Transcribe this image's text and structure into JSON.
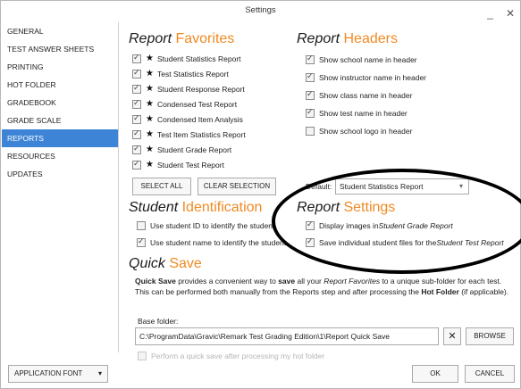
{
  "window": {
    "title": "Settings",
    "minimize_label": "_",
    "close_label": "✕"
  },
  "sidebar": {
    "items": [
      {
        "label": "GENERAL"
      },
      {
        "label": "TEST ANSWER SHEETS"
      },
      {
        "label": "PRINTING"
      },
      {
        "label": "HOT FOLDER"
      },
      {
        "label": "GRADEBOOK"
      },
      {
        "label": "GRADE SCALE"
      },
      {
        "label": "REPORTS",
        "active": true
      },
      {
        "label": "RESOURCES"
      },
      {
        "label": "UPDATES"
      }
    ]
  },
  "report_favorites": {
    "title_main": "Report",
    "title_accent": "Favorites",
    "items": [
      {
        "label": "Student Statistics Report",
        "checked": true
      },
      {
        "label": "Test Statistics Report",
        "checked": true
      },
      {
        "label": "Student Response Report",
        "checked": true
      },
      {
        "label": "Condensed Test Report",
        "checked": true
      },
      {
        "label": "Condensed Item Analysis",
        "checked": true
      },
      {
        "label": "Test Item Statistics Report",
        "checked": true
      },
      {
        "label": "Student Grade Report",
        "checked": true
      },
      {
        "label": "Student Test Report",
        "checked": true
      }
    ],
    "select_all_label": "SELECT ALL",
    "clear_selection_label": "CLEAR SELECTION"
  },
  "report_headers": {
    "title_main": "Report",
    "title_accent": "Headers",
    "items": [
      {
        "label": "Show school name in header",
        "checked": true
      },
      {
        "label": "Show instructor name in header",
        "checked": true
      },
      {
        "label": "Show class name in header",
        "checked": true
      },
      {
        "label": "Show test name in header",
        "checked": true
      },
      {
        "label": "Show school logo in header",
        "checked": false
      }
    ],
    "default_label": "Default:",
    "default_value": "Student Statistics Report"
  },
  "student_identification": {
    "title_main": "Student",
    "title_accent": "Identification",
    "items": [
      {
        "label": "Use student ID to identify the student",
        "checked": false
      },
      {
        "label": "Use student name to identify the student",
        "checked": true
      }
    ]
  },
  "report_settings": {
    "title_main": "Report",
    "title_accent": "Settings",
    "items": [
      {
        "label_prefix": "Display images in ",
        "label_italic": "Student Grade Report",
        "checked": true
      },
      {
        "label_prefix": "Save individual student files for the ",
        "label_italic": "Student Test Report",
        "checked": true
      }
    ]
  },
  "quick_save": {
    "title_main": "Quick",
    "title_accent": "Save",
    "description_bold": "Quick Save",
    "description_1": " provides a convenient way to ",
    "description_bold2": "save",
    "description_2": " all your ",
    "description_italic": "Report Favorites",
    "description_3": " to a unique sub-folder for each test. This can be performed both manually from the Reports step and after processing the ",
    "description_bold3": "Hot Folder",
    "description_4": " (if applicable).",
    "base_folder_label": "Base folder:",
    "base_folder_value": "C:\\ProgramData\\Gravic\\Remark Test Grading Edition\\1\\Report Quick Save",
    "clear_glyph": "✕",
    "browse_label": "BROWSE",
    "auto_save_label": "Perform a quick save after processing my hot folder",
    "auto_save_checked": false
  },
  "footer": {
    "app_font_label": "APPLICATION FONT",
    "ok_label": "OK",
    "cancel_label": "CANCEL"
  },
  "colors": {
    "accent_orange": "#f08a24",
    "sidebar_active": "#3d84d6"
  }
}
